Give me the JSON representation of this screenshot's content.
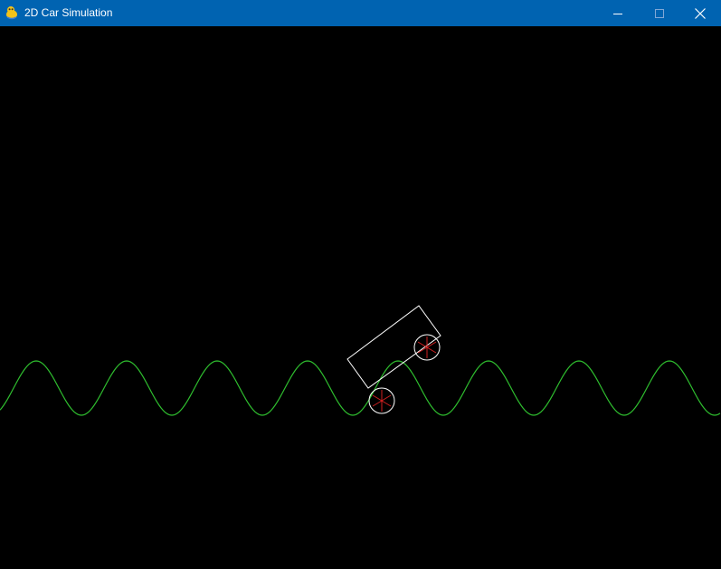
{
  "window": {
    "title": "2D Car Simulation",
    "icon": "pygame-snake-icon"
  },
  "controls": {
    "minimize_icon": "minimize-icon",
    "maximize_icon": "maximize-icon",
    "close_icon": "close-icon"
  },
  "colors": {
    "titlebar": "#0063b1",
    "background": "#000000",
    "terrain": "#2fbf2f",
    "car_outline": "#ffffff",
    "wheel_spokes": "#d02020"
  }
}
